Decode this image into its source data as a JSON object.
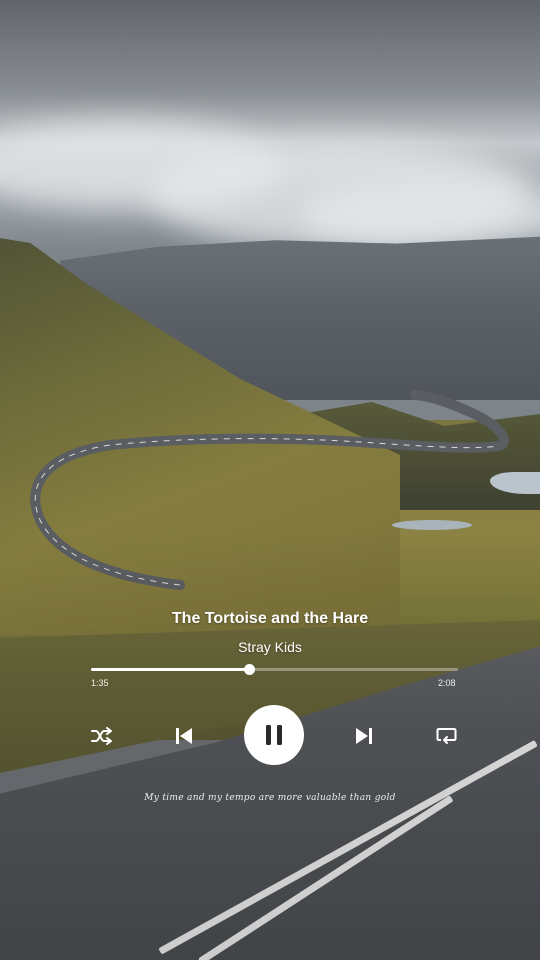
{
  "player": {
    "song_title": "The Tortoise and the Hare",
    "artist": "Stray Kids",
    "elapsed": "1:35",
    "duration": "2:08",
    "progress_fraction": 0.43,
    "lyric": "My time and my tempo are more valuable than gold"
  },
  "controls": {
    "shuffle_icon": "shuffle-icon",
    "previous_icon": "skip-previous-icon",
    "play_pause_icon": "pause-icon",
    "next_icon": "skip-next-icon",
    "repeat_icon": "repeat-icon"
  },
  "colors": {
    "accent": "#ffffff",
    "track": "#ffffff59"
  }
}
